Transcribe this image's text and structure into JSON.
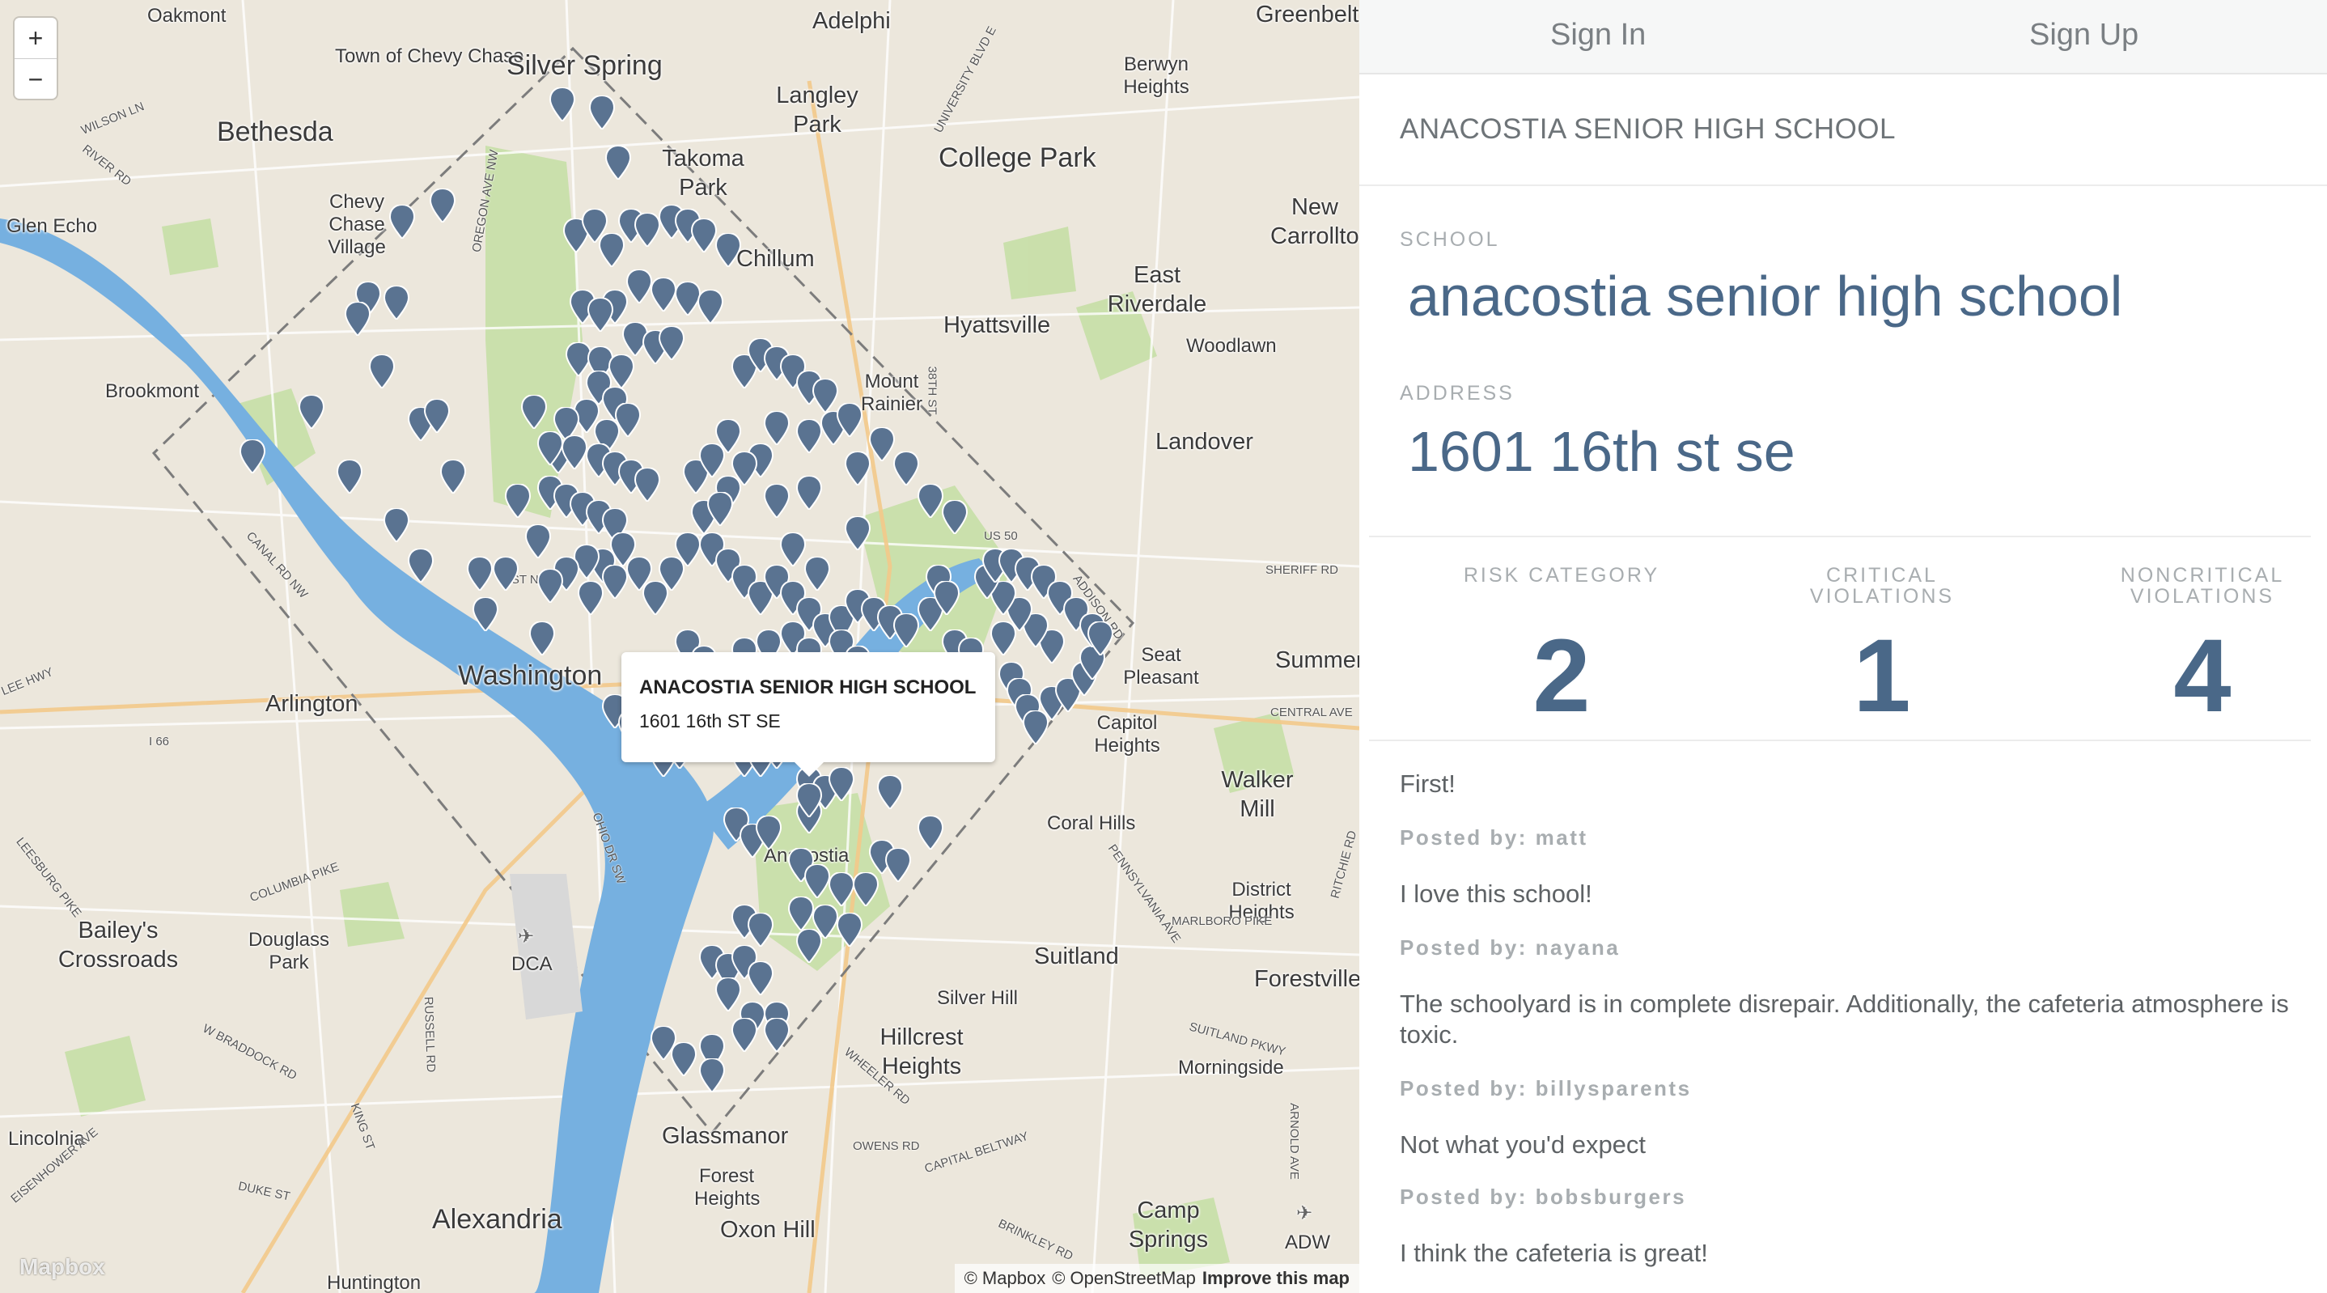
{
  "nav": {
    "sign_in": "Sign In",
    "sign_up": "Sign Up"
  },
  "header": {
    "title": "ANACOSTIA SENIOR HIGH SCHOOL"
  },
  "school": {
    "school_label": "SCHOOL",
    "name": "anacostia senior high school",
    "address_label": "ADDRESS",
    "address": "1601 16th st se"
  },
  "stats": [
    {
      "label": "RISK CATEGORY",
      "value": "2"
    },
    {
      "label": "CRITICAL VIOLATIONS",
      "value": "1"
    },
    {
      "label": "NONCRITICAL VIOLATIONS",
      "value": "4"
    }
  ],
  "comments": [
    {
      "text": "First!",
      "posted_by": "Posted by: matt"
    },
    {
      "text": "I love this school!",
      "posted_by": "Posted by: nayana"
    },
    {
      "text": "The schoolyard is in complete disrepair. Additionally, the cafeteria atmosphere is toxic.",
      "posted_by": "Posted by: billysparents"
    },
    {
      "text": "Not what you'd expect",
      "posted_by": "Posted by: bobsburgers"
    },
    {
      "text": "I think the cafeteria is great!",
      "posted_by": ""
    }
  ],
  "map": {
    "zoom_in": "+",
    "zoom_out": "−",
    "popup": {
      "title": "ANACOSTIA SENIOR HIGH SCHOOL",
      "address": "1601 16th ST SE"
    },
    "attribution": {
      "mapbox": "© Mapbox",
      "osm": "© OpenStreetMap",
      "improve": "Improve this map"
    },
    "logo": "Mapbox",
    "places": [
      "Oakmont",
      "Adelphi",
      "Greenbelt",
      "Town of Chevy Chase",
      "Silver Spring",
      "Langley Park",
      "Berwyn Heights",
      "Bethesda",
      "Takoma Park",
      "College Park",
      "Chevy Chase Village",
      "New Carrollton",
      "Glen Echo",
      "Chillum",
      "East Riverdale",
      "Hyattsville",
      "Woodlawn",
      "Brookmont",
      "Mount Rainier",
      "Landover",
      "Washington",
      "Arlington",
      "Seat Pleasant",
      "Capitol Heights",
      "Summerfield",
      "Walker Mill",
      "Coral Hills",
      "Anacostia",
      "District Heights",
      "Bailey's Crossroads",
      "Douglass Park",
      "DCA",
      "Suitland",
      "Forestville",
      "Silver Hill",
      "Hillcrest Heights",
      "Morningside",
      "Glassmanor",
      "Forest Heights",
      "Lincolnia",
      "Alexandria",
      "Oxon Hill",
      "Camp Springs",
      "ADW",
      "Huntington"
    ],
    "roads": [
      "WILSON LN",
      "RIVER RD",
      "OREGON AVE NW",
      "38TH ST",
      "US 50",
      "CANAL RD NW",
      "Q ST NW",
      "SHERIFF RD",
      "ADDISON RD",
      "CENTRAL AVE",
      "I 66",
      "LEE HWY",
      "COLUMBIA PIKE",
      "LEESBURG PIKE",
      "OHIO DR SW",
      "PENNSYLVANIA AVE",
      "MARLBORO PIKE",
      "RITCHIE RD",
      "SUITLAND PKWY",
      "WHEELER RD",
      "OWENS RD",
      "CAPITAL BELTWAY",
      "ARNOLD AVE",
      "BRINKLEY RD",
      "DUKE ST",
      "EISENHOWER AVE",
      "KING ST",
      "RUSSELL RD",
      "W BRADDOCK RD",
      "UNIVERSITY BLVD E"
    ]
  },
  "colors": {
    "pin": "#5a7391",
    "water": "#76b0e0",
    "park": "#b8d99a",
    "accent": "#4a6888"
  }
}
